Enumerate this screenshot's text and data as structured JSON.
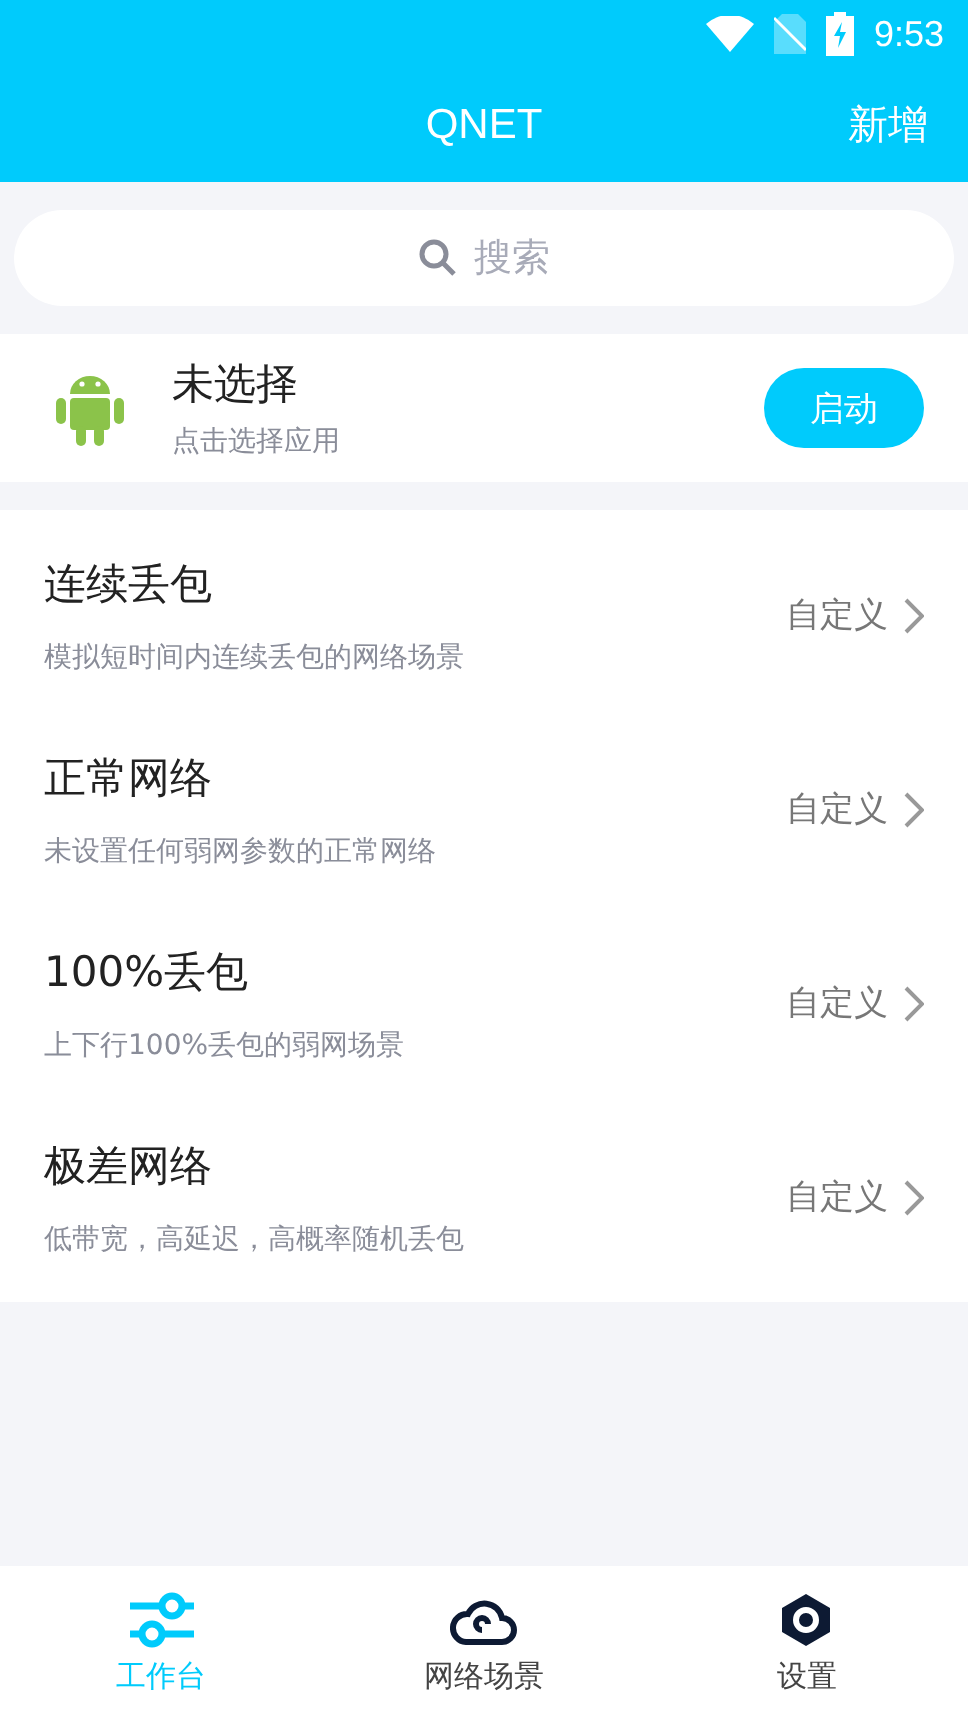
{
  "status_bar": {
    "time": "9:53"
  },
  "header": {
    "title": "QNET",
    "action": "新增"
  },
  "search": {
    "placeholder": "搜索"
  },
  "app": {
    "name": "未选择",
    "hint": "点击选择应用",
    "button": "启动"
  },
  "scenes": [
    {
      "title": "连续丢包",
      "description": "模拟短时间内连续丢包的网络场景",
      "action": "自定义"
    },
    {
      "title": "正常网络",
      "description": "未设置任何弱网参数的正常网络",
      "action": "自定义"
    },
    {
      "title": "100%丢包",
      "description": "上下行100%丢包的弱网场景",
      "action": "自定义"
    },
    {
      "title": "极差网络",
      "description": "低带宽，高延迟，高概率随机丢包",
      "action": "自定义"
    }
  ],
  "tabs": [
    {
      "kind": "sliders",
      "label": "工作台",
      "selected": true
    },
    {
      "kind": "cloud",
      "label": "网络场景",
      "selected": false
    },
    {
      "kind": "settings",
      "label": "设置",
      "selected": false
    }
  ]
}
